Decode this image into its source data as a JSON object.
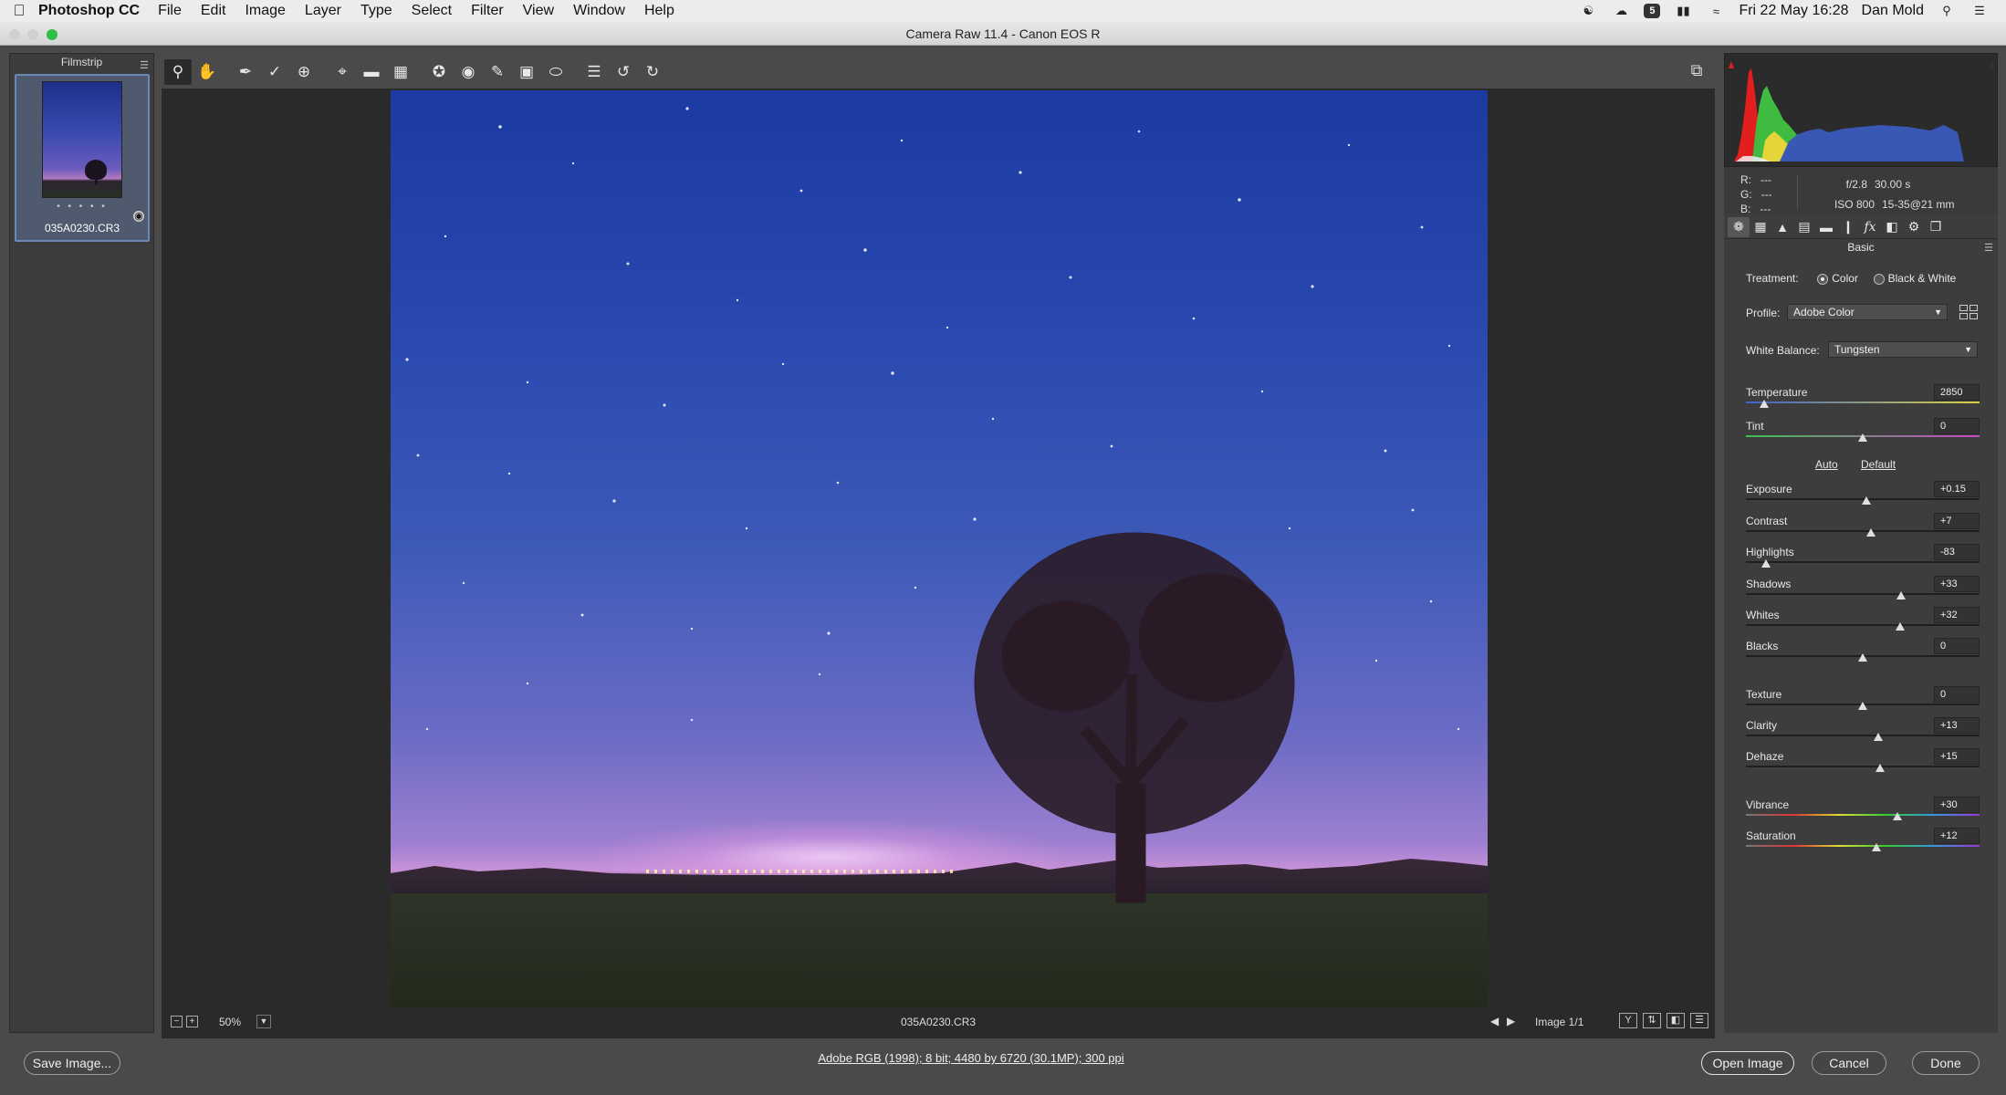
{
  "menubar": {
    "app": "Photoshop CC",
    "items": [
      "File",
      "Edit",
      "Image",
      "Layer",
      "Type",
      "Select",
      "Filter",
      "View",
      "Window",
      "Help"
    ],
    "clock": "Fri 22 May  16:28",
    "user": "Dan Mold",
    "status_badge": "5"
  },
  "window": {
    "title": "Camera Raw 11.4  -  Canon EOS R"
  },
  "filmstrip": {
    "title": "Filmstrip",
    "thumb_filename": "035A0230.CR3",
    "rating_dots": "• • • • •"
  },
  "preview": {
    "zoom": "50%",
    "filename": "035A0230.CR3",
    "image_counter": "Image 1/1",
    "view_buttons": [
      "Y",
      "⇅",
      "◧",
      "☰"
    ]
  },
  "exif": {
    "r_label": "R:",
    "g_label": "G:",
    "b_label": "B:",
    "r_value": "---",
    "g_value": "---",
    "b_value": "---",
    "aperture": "f/2.8",
    "shutter": "30.00 s",
    "iso": "ISO 800",
    "lens": "15-35@21 mm"
  },
  "basic_panel": {
    "title": "Basic",
    "treatment_label": "Treatment:",
    "treatment_color": "Color",
    "treatment_bw": "Black & White",
    "profile_label": "Profile:",
    "profile_value": "Adobe Color",
    "wb_label": "White Balance:",
    "wb_value": "Tungsten",
    "auto_label": "Auto",
    "default_label": "Default",
    "sliders": [
      {
        "label": "Temperature",
        "value": "2850",
        "position": 0.08
      },
      {
        "label": "Tint",
        "value": "0",
        "position": 0.5
      },
      {
        "label": "Exposure",
        "value": "+0.15",
        "position": 0.515
      },
      {
        "label": "Contrast",
        "value": "+7",
        "position": 0.535
      },
      {
        "label": "Highlights",
        "value": "-83",
        "position": 0.085
      },
      {
        "label": "Shadows",
        "value": "+33",
        "position": 0.665
      },
      {
        "label": "Whites",
        "value": "+32",
        "position": 0.66
      },
      {
        "label": "Blacks",
        "value": "0",
        "position": 0.5
      },
      {
        "label": "Texture",
        "value": "0",
        "position": 0.5
      },
      {
        "label": "Clarity",
        "value": "+13",
        "position": 0.565
      },
      {
        "label": "Dehaze",
        "value": "+15",
        "position": 0.575
      },
      {
        "label": "Vibrance",
        "value": "+30",
        "position": 0.65
      },
      {
        "label": "Saturation",
        "value": "+12",
        "position": 0.56
      }
    ]
  },
  "bottom": {
    "save_label": "Save Image...",
    "workflow_text": "Adobe RGB (1998); 8 bit; 4480 by 6720 (30.1MP); 300 ppi",
    "open_label": "Open Image",
    "cancel_label": "Cancel",
    "done_label": "Done"
  },
  "icons": {
    "toolbar": [
      "zoom-icon",
      "hand-icon",
      "white-balance-icon",
      "color-sampler-icon",
      "targeted-adjustment-icon",
      "crop-icon",
      "straighten-icon",
      "transform-icon",
      "spot-removal-icon",
      "red-eye-icon",
      "adjustment-brush-icon",
      "graduated-filter-icon",
      "radial-filter-icon",
      "preferences-icon",
      "rotate-left-icon",
      "rotate-right-icon"
    ],
    "panel_tabs": [
      "basic-tab-icon",
      "tone-curve-icon",
      "detail-icon",
      "hsl-icon",
      "split-toning-icon",
      "lens-corrections-icon",
      "effects-icon",
      "calibration-icon",
      "presets-icon",
      "snapshots-icon"
    ]
  }
}
